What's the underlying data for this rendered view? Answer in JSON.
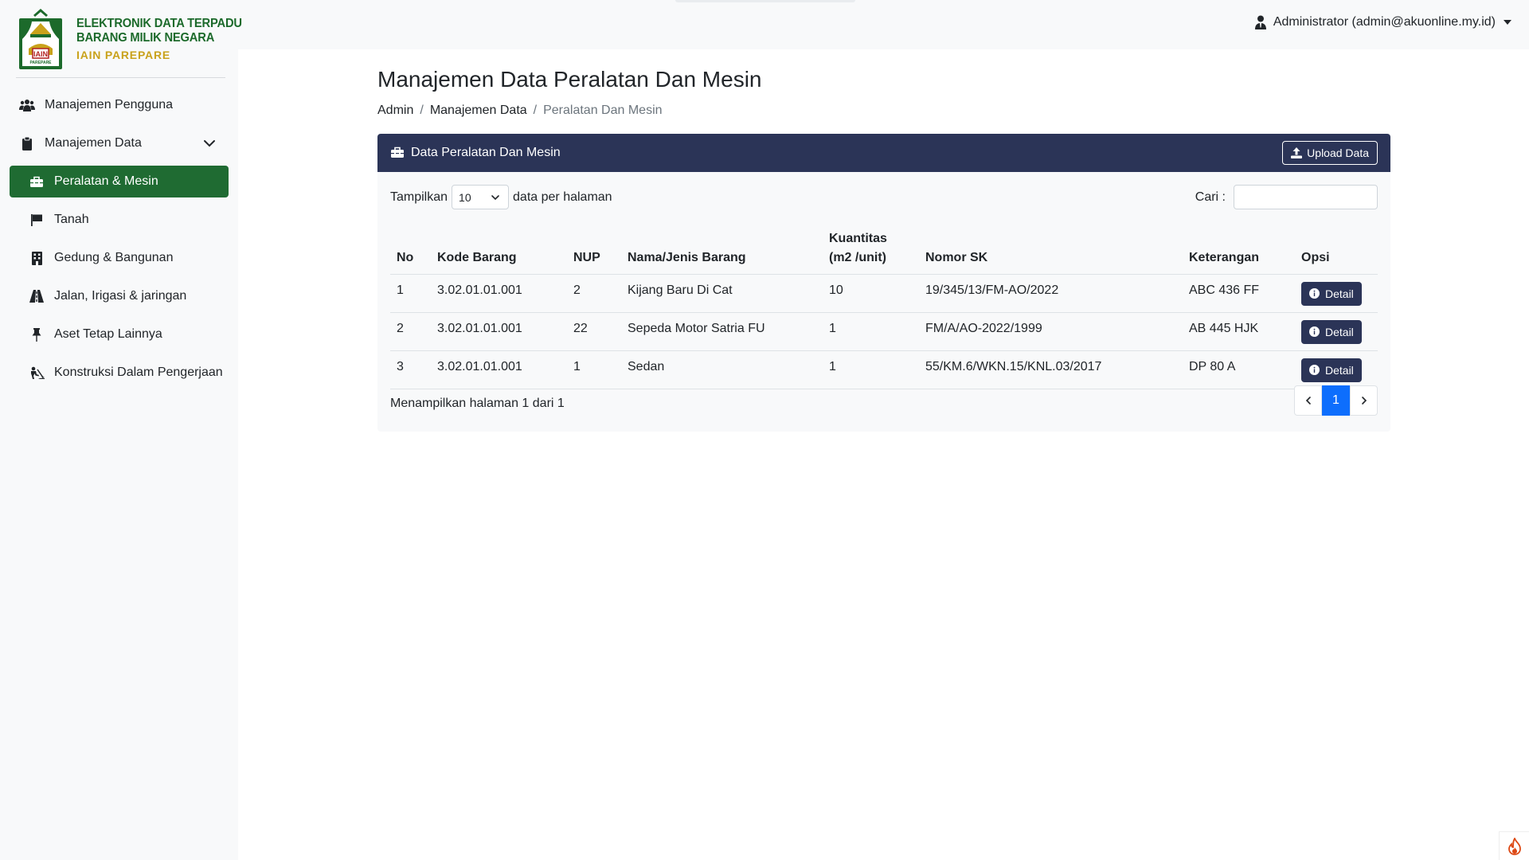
{
  "brand": {
    "line1": "ELEKTRONIK DATA TERPADU",
    "line2": "BARANG MILIK NEGARA",
    "line3": "IAIN PAREPARE",
    "logo_text": "IAIN",
    "logo_subtext": "PAREPARE"
  },
  "user": {
    "label": "Administrator (admin@akuonline.my.id)",
    "icon": "user-tie-icon"
  },
  "sidebar": {
    "items": [
      {
        "label": "Manajemen Pengguna",
        "icon": "users-icon"
      },
      {
        "label": "Manajemen Data",
        "icon": "clipboard-icon",
        "expanded": true
      }
    ],
    "subitems": [
      {
        "label": "Peralatan & Mesin",
        "icon": "toolbox-icon",
        "active": true
      },
      {
        "label": "Tanah",
        "icon": "flag-icon"
      },
      {
        "label": "Gedung & Bangunan",
        "icon": "building-icon"
      },
      {
        "label": "Jalan, Irigasi & jaringan",
        "icon": "road-icon"
      },
      {
        "label": "Aset Tetap Lainnya",
        "icon": "thumbtack-icon"
      },
      {
        "label": "Konstruksi Dalam Pengerjaan",
        "icon": "person-digging-icon"
      }
    ]
  },
  "page": {
    "title": "Manajemen Data Peralatan Dan Mesin",
    "breadcrumb": [
      "Admin",
      "Manajemen Data",
      "Peralatan Dan Mesin"
    ]
  },
  "card": {
    "title": "Data Peralatan Dan Mesin",
    "upload_label": "Upload Data",
    "show_prefix": "Tampilkan",
    "show_value": "10",
    "show_suffix": "data per halaman",
    "search_label": "Cari :",
    "search_value": "",
    "headers": {
      "no": "No",
      "kode": "Kode Barang",
      "nup": "NUP",
      "nama": "Nama/Jenis Barang",
      "kuantitas_1": "Kuantitas",
      "kuantitas_2": "(m2 /unit)",
      "sk": "Nomor SK",
      "ket": "Keterangan",
      "opsi": "Opsi"
    },
    "rows": [
      {
        "no": "1",
        "kode": "3.02.01.01.001",
        "nup": "2",
        "nama": "Kijang Baru Di Cat",
        "kuantitas": "10",
        "sk": "19/345/13/FM-AO/2022",
        "ket": "ABC 436 FF",
        "action": "Detail"
      },
      {
        "no": "2",
        "kode": "3.02.01.01.001",
        "nup": "22",
        "nama": "Sepeda Motor Satria FU",
        "kuantitas": "1",
        "sk": "FM/A/AO-2022/1999",
        "ket": "AB 445 HJK",
        "action": "Detail"
      },
      {
        "no": "3",
        "kode": "3.02.01.01.001",
        "nup": "1",
        "nama": "Sedan",
        "kuantitas": "1",
        "sk": "55/KM.6/WKN.15/KNL.03/2017",
        "ket": "DP 80 A",
        "action": "Detail"
      }
    ],
    "footer_info": "Menampilkan halaman 1 dari 1",
    "current_page": "1"
  },
  "colors": {
    "sidebar_active": "#1f6b32",
    "card_header": "#2b3457",
    "brand_green": "#1c6a2b",
    "brand_gold": "#c9a21b",
    "page_active": "#0d6efd"
  }
}
